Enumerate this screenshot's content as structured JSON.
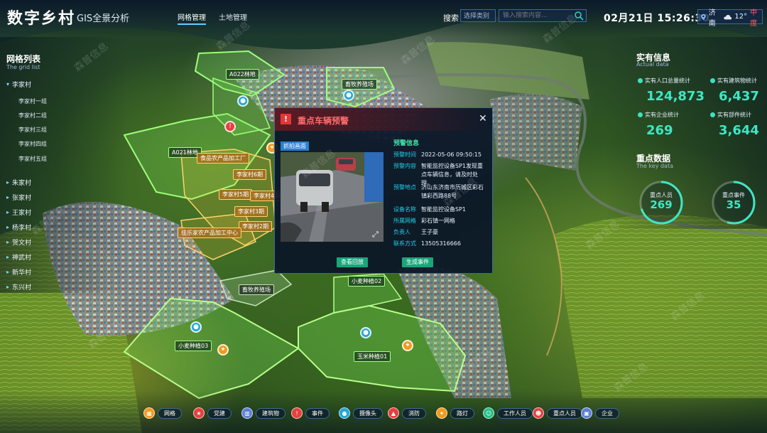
{
  "header": {
    "title": "数字乡村",
    "subtitle": "GIS全景分析",
    "tabs": [
      {
        "label": "网格管理"
      },
      {
        "label": "土地管理"
      }
    ],
    "search_label": "搜索",
    "search_type_placeholder": "选择类别",
    "search_placeholder": "输入搜索内容...",
    "datetime": "02月21日 15:26:30",
    "weather": {
      "city": "济南",
      "temp": "12°",
      "aqi": "中度"
    }
  },
  "grid_list": {
    "title": "网格列表",
    "subtitle": "The grid list",
    "top_village": "李家村",
    "sub_items": [
      "李家村一组",
      "李家村二组",
      "李家村三组",
      "李家村四组",
      "李家村五组"
    ],
    "villages": [
      "朱家村",
      "张家村",
      "王家村",
      "杨李村",
      "贺文村",
      "神武村",
      "新华村",
      "东兴村"
    ]
  },
  "right_panel": {
    "info_title": "实有信息",
    "info_sub": "Actual data",
    "stats": [
      {
        "label": "实有人口总量统计",
        "value": "124,873"
      },
      {
        "label": "实有建筑物统计",
        "value": "6,437"
      },
      {
        "label": "实有企业统计",
        "value": "269"
      },
      {
        "label": "实有部件统计",
        "value": "3,644"
      }
    ],
    "key_title": "重点数据",
    "key_sub": "The key data",
    "key_rings": [
      {
        "label": "重点人员",
        "value": "269",
        "ratio": 0.7
      },
      {
        "label": "重点事件",
        "value": "35",
        "ratio": 0.55
      }
    ]
  },
  "map": {
    "labels": [
      "A022林地",
      "畜牧养殖场",
      "A021林地",
      "食品农产品加工厂",
      "李家村6期",
      "李家村5期",
      "李家村4期",
      "李家村3期",
      "李家村2期",
      "佳乐家农产品加工中心",
      "小麦种植02",
      "畜牧养殖场",
      "小麦种植03",
      "玉米种植01"
    ]
  },
  "modal": {
    "title": "重点车辆预警",
    "snapshot_label": "抓拍画面",
    "section_title": "预警信息",
    "fields": [
      {
        "k": "预警时间",
        "v": "2022-05-06  09:50:15"
      },
      {
        "k": "预警内容",
        "v": "智能监控设备SP1发现重点车辆信息，请及时处理。"
      },
      {
        "k": "预警地点",
        "v": "济山东济南市历城区彩石镇彩西路88号"
      },
      {
        "k": "设备名称",
        "v": "智能监控设备SP1"
      },
      {
        "k": "所属网格",
        "v": "彩石镇一网格"
      },
      {
        "k": "负责人",
        "v": "王子豪"
      },
      {
        "k": "联系方式",
        "v": "13505316666"
      }
    ],
    "btn_playback": "查看回放",
    "btn_create": "生成事件"
  },
  "toolbar": [
    {
      "label": "网格",
      "icon": "grid-icon",
      "color": "#f39a1d"
    },
    {
      "label": "党建",
      "icon": "party-icon",
      "color": "#e3413f"
    },
    {
      "label": "建筑物",
      "icon": "building-icon",
      "color": "#5a7fd6"
    },
    {
      "label": "事件",
      "icon": "alert-icon",
      "color": "#e3413f"
    },
    {
      "label": "摄像头",
      "icon": "camera-icon",
      "color": "#22a7d8"
    },
    {
      "label": "消防",
      "icon": "fire-icon",
      "color": "#e3413f"
    },
    {
      "label": "路灯",
      "icon": "light-icon",
      "color": "#f39a1d"
    },
    {
      "label": "工作人员",
      "icon": "staff-icon",
      "color": "#1fbf86"
    },
    {
      "label": "重点人员",
      "icon": "person-icon",
      "color": "#e3413f"
    },
    {
      "label": "企业",
      "icon": "enterprise-icon",
      "color": "#5a7fd6"
    }
  ],
  "watermark": "森普信息"
}
